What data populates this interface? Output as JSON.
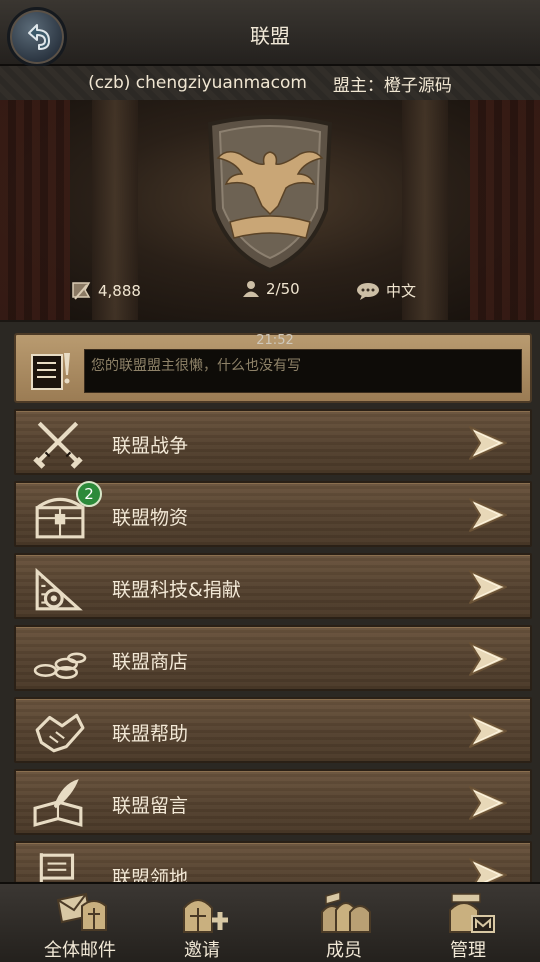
{
  "header": {
    "title": "联盟",
    "back_icon": "back-arrow-icon"
  },
  "info": {
    "alliance_name": "(czb) chengziyuanmacom",
    "leader": "盟主：橙子源码"
  },
  "banner": {
    "emblem_icon": "eagle-shield-icon",
    "power": "4,888",
    "members": "2/50",
    "language": "中文"
  },
  "notice": {
    "time": "21:52",
    "text": "您的联盟盟主很懒，什么也没有写"
  },
  "menu": [
    {
      "label": "联盟战争",
      "icon": "crossed-swords-icon"
    },
    {
      "label": "联盟物资",
      "icon": "treasure-chest-icon",
      "badge": "2"
    },
    {
      "label": "联盟科技&捐献",
      "icon": "gear-ruler-icon"
    },
    {
      "label": "联盟商店",
      "icon": "coins-icon"
    },
    {
      "label": "联盟帮助",
      "icon": "handshake-icon"
    },
    {
      "label": "联盟留言",
      "icon": "quill-book-icon"
    },
    {
      "label": "联盟领地",
      "icon": "flag-icon"
    }
  ],
  "tabs": [
    {
      "label": "全体邮件",
      "icon": "mail-helmet-icon"
    },
    {
      "label": "邀请",
      "icon": "helmet-plus-icon"
    },
    {
      "label": "成员",
      "icon": "helmets-group-icon"
    },
    {
      "label": "管理",
      "icon": "helmet-manage-icon"
    }
  ]
}
